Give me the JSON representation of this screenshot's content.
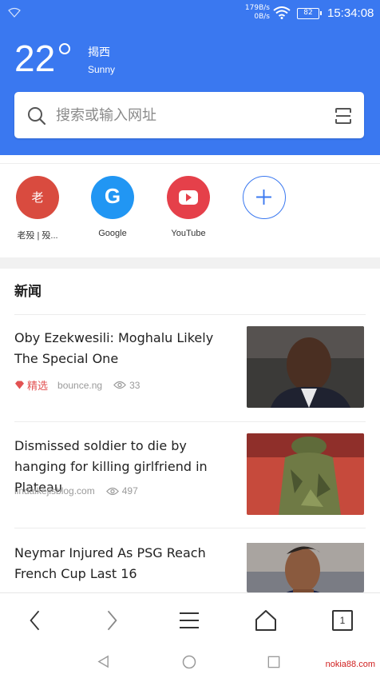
{
  "status": {
    "speed_up": "179B/s",
    "speed_down": "0B/s",
    "battery": "82",
    "time": "15:34:08"
  },
  "weather": {
    "temperature": "22",
    "city": "揭西",
    "condition": "Sunny"
  },
  "search": {
    "placeholder": "搜索或输入网址"
  },
  "shortcuts": [
    {
      "label": "老殁 | 殁...",
      "glyph": "老",
      "color": "#d94b3f"
    },
    {
      "label": "Google",
      "glyph": "G",
      "color": "#2196f3"
    },
    {
      "label": "YouTube",
      "glyph": "youtube-icon",
      "color": "#e5404a"
    },
    {
      "label": "",
      "glyph": "add-icon",
      "color": "#3a78f0"
    }
  ],
  "news": {
    "section_title": "新闻",
    "items": [
      {
        "headline": "Oby Ezekwesili: Moghalu Likely The Special One",
        "featured": "精选",
        "source": "bounce.ng",
        "views": "33"
      },
      {
        "headline": "Dismissed soldier to die by hanging for killing girlfriend in Plateau",
        "source": "lindaikejisblog.com",
        "views": "497"
      },
      {
        "headline": "Neymar Injured As PSG Reach French Cup Last 16",
        "source": "",
        "views": ""
      }
    ]
  },
  "bottom_nav": {
    "tab_count": "1"
  },
  "watermark": "nokia88.com"
}
